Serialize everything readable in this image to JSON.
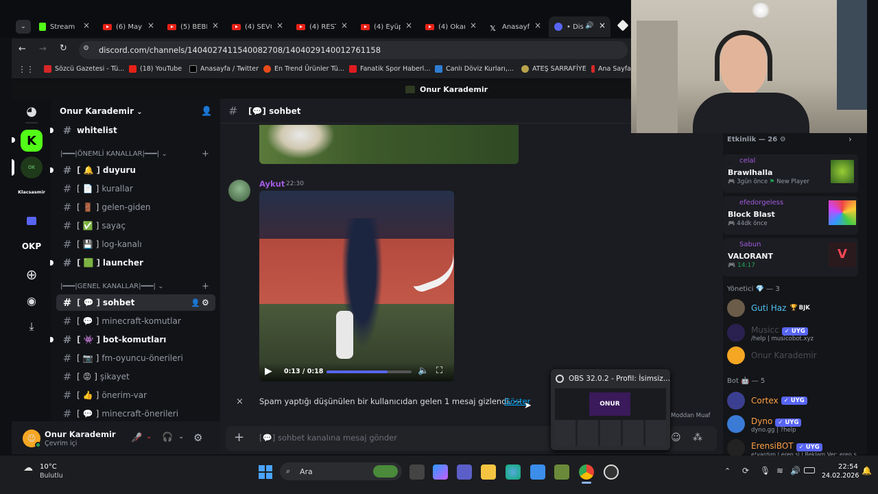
{
  "browser": {
    "tabs": [
      {
        "label": "Stream -",
        "icon": "kick-icon"
      },
      {
        "label": "(6) Mayı",
        "icon": "youtube-icon"
      },
      {
        "label": "(5) BEBE",
        "icon": "youtube-icon"
      },
      {
        "label": "(4) SEVG",
        "icon": "youtube-icon"
      },
      {
        "label": "(4) REST",
        "icon": "youtube-icon"
      },
      {
        "label": "(4) Eyüp",
        "icon": "youtube-icon"
      },
      {
        "label": "(4) Okan",
        "icon": "youtube-icon"
      },
      {
        "label": "Anasayfa",
        "icon": "x-icon"
      },
      {
        "label": "• Dis",
        "icon": "discord-icon"
      }
    ],
    "url": "discord.com/channels/1404027411540082708/1404029140012761158",
    "bookmarks": [
      {
        "label": "Sözcü Gazetesi - Tü...",
        "color": "#d62828"
      },
      {
        "label": "(18) YouTube",
        "color": "#e62117"
      },
      {
        "label": "Anasayfa / Twitter",
        "color": "#000000"
      },
      {
        "label": "En Trend Ürünler Tü...",
        "color": "#e94b1b"
      },
      {
        "label": "Fanatik Spor Haberl...",
        "color": "#e11b22"
      },
      {
        "label": "Canlı Döviz Kurları,...",
        "color": "#2e7dd1"
      },
      {
        "label": "ATEŞ SARRAFİYE",
        "color": "#b8a24a"
      },
      {
        "label": "Ana Sayfa",
        "color": "#d62828"
      }
    ],
    "window_title": "Onur Karademir"
  },
  "guilds": {
    "items": [
      {
        "label": "Klacsasmir",
        "icon": "server-logo"
      },
      {
        "label": "OKP",
        "icon": "server-initials"
      }
    ]
  },
  "server": {
    "name": "Onur Karademir",
    "pinned_channel": "whitelist",
    "categories": [
      {
        "label": "|━━━|ÖNEMLİ KANALLAR|━━━|"
      },
      {
        "label": "|━━━|GENEL KANALLAR|━━━|"
      }
    ],
    "channels": [
      {
        "bracket_emoji": "🔔",
        "name": "duyuru",
        "unread": true
      },
      {
        "bracket_emoji": "📄",
        "name": "kurallar",
        "unread": false
      },
      {
        "bracket_emoji": "🚪",
        "name": "gelen-giden",
        "unread": false
      },
      {
        "bracket_emoji": "✅",
        "name": "sayaç",
        "unread": false
      },
      {
        "bracket_emoji": "💾",
        "name": "log-kanalı",
        "unread": false
      },
      {
        "bracket_emoji": "🟩",
        "name": "launcher",
        "unread": true
      },
      {
        "bracket_emoji": "💬",
        "name": "sohbet",
        "unread": false,
        "selected": true
      },
      {
        "bracket_emoji": "💬",
        "name": "minecraft-komutlar",
        "unread": false
      },
      {
        "bracket_emoji": "👾",
        "name": "bot-komutları",
        "unread": true
      },
      {
        "bracket_emoji": "📷",
        "name": "fm-oyuncu-önerileri",
        "unread": false
      },
      {
        "bracket_emoji": "😡",
        "name": "şikayet",
        "unread": false
      },
      {
        "bracket_emoji": "👍",
        "name": "önerim-var",
        "unread": false
      },
      {
        "bracket_emoji": "💬",
        "name": "minecraft-önerileri",
        "unread": false
      }
    ]
  },
  "user": {
    "name": "Onur Karademir",
    "status": "Çevrim içi"
  },
  "chat": {
    "channel_title": "[💬] sohbet",
    "message": {
      "author": "Aykut",
      "time": "22:30"
    },
    "video": {
      "time": "0:13 / 0:18",
      "progress": 0.72
    },
    "notice": "Spam yaptığı düşünülen bir kullanıcıdan gelen 1 mesaj gizlendi. —",
    "notice_link": "Göster",
    "composer_placeholder": "[💬] sohbet kanalına mesaj gönder"
  },
  "members": {
    "activity_header": "Etkinlik — 26",
    "activities": [
      {
        "user": "celal",
        "game": "Brawlhalla",
        "meta": "3gün önce",
        "extra": "New Player"
      },
      {
        "user": "efedorgeless",
        "game": "Block Blast",
        "meta": "44dk önce",
        "extra": ""
      },
      {
        "user": "Sabun",
        "game": "VALORANT",
        "meta": "14:17",
        "extra": ""
      }
    ],
    "groups": [
      {
        "title": "Yönetici 💎 — 3",
        "members": [
          {
            "name": "Guti Haz",
            "tag": "BJK",
            "sub": "",
            "color": "#4fc3f7"
          },
          {
            "name": "Musicc",
            "tag": "UYG",
            "sub": "/help | musicobot.xyz",
            "color": "#6a6e75"
          },
          {
            "name": "Onur Karademir",
            "tag": "",
            "sub": "",
            "color": "#6a6e75"
          }
        ]
      },
      {
        "title": "Bot 🤖 — 5",
        "members": [
          {
            "name": "Cortex",
            "tag": "UYG",
            "sub": "",
            "color": "#ff9f43"
          },
          {
            "name": "Dyno",
            "tag": "UYG",
            "sub": "dyno.gg | ?help",
            "color": "#ff9f43"
          },
          {
            "name": "ErensiBOT",
            "tag": "UYG",
            "sub": "e!yardım | eren.si | Reklam Ver: eren.s",
            "color": "#ff9f43"
          }
        ]
      }
    ],
    "truncated_name": "Moddan Muaf"
  },
  "obs_preview": {
    "title": "OBS 32.0.2 - Profil: İsimsiz..."
  },
  "taskbar": {
    "weather_temp": "10°C",
    "weather_desc": "Bulutlu",
    "search_label": "Ara",
    "time": "22:54",
    "date": "24.02.2026"
  }
}
